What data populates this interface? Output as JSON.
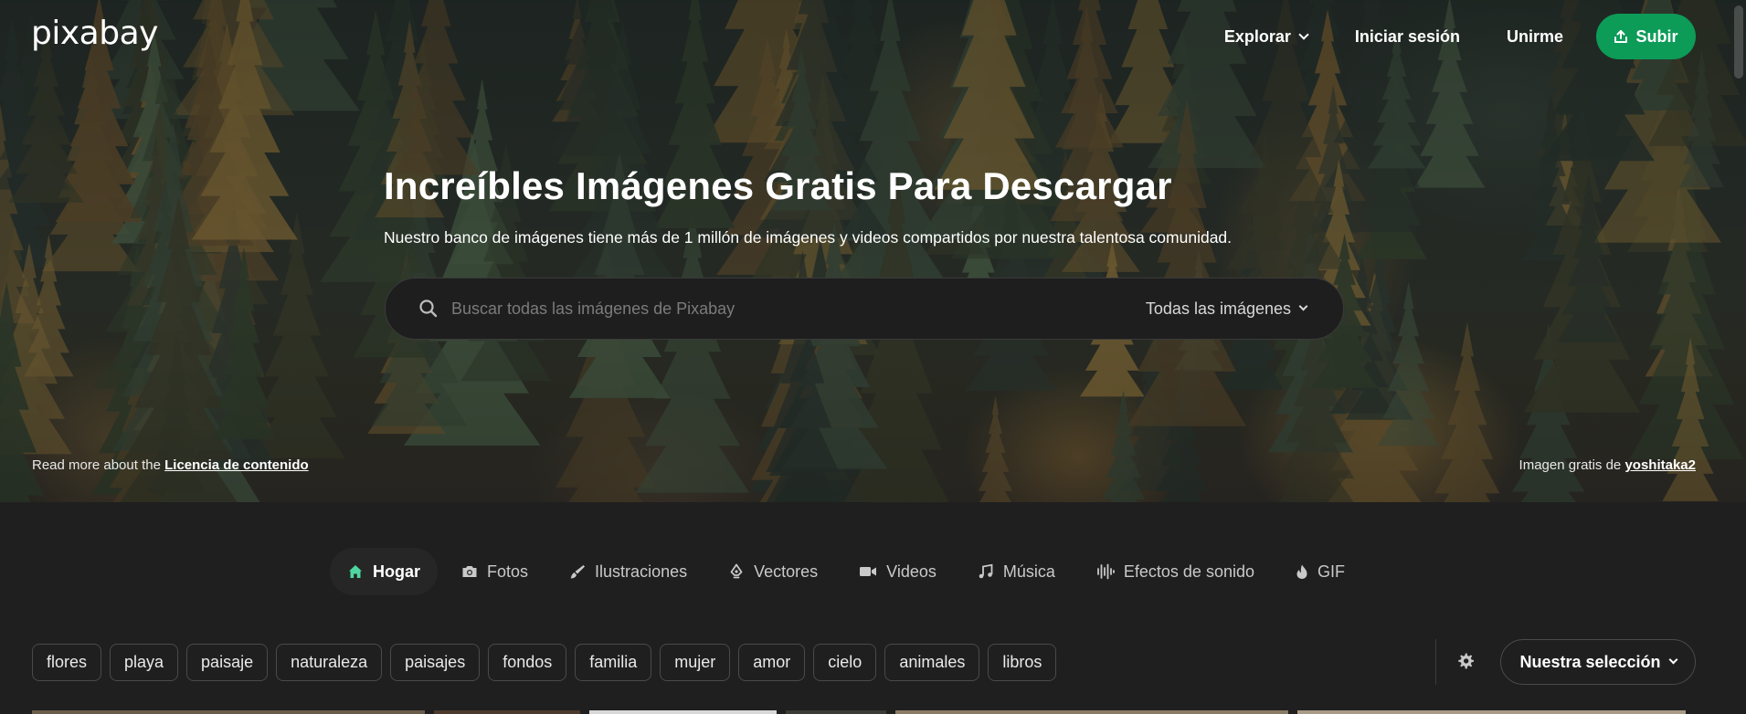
{
  "header": {
    "logo": "pixabay",
    "nav": {
      "explore": "Explorar",
      "login": "Iniciar sesión",
      "join": "Unirme",
      "upload": "Subir"
    }
  },
  "hero": {
    "title": "Increíbles Imágenes Gratis Para Descargar",
    "subtitle": "Nuestro banco de imágenes tiene más de 1 millón de imágenes y videos compartidos por nuestra talentosa comunidad.",
    "search": {
      "placeholder": "Buscar todas las imágenes de Pixabay",
      "value": "",
      "scope": "Todas las imágenes"
    },
    "footer_left": {
      "prefix": "Read more about the",
      "link": "Licencia de contenido"
    },
    "footer_right": {
      "prefix": "Imagen gratis de",
      "author": "yoshitaka2"
    }
  },
  "tabs": [
    {
      "label": "Hogar",
      "icon": "home-icon",
      "active": true
    },
    {
      "label": "Fotos",
      "icon": "camera-icon",
      "active": false
    },
    {
      "label": "Ilustraciones",
      "icon": "brush-icon",
      "active": false
    },
    {
      "label": "Vectores",
      "icon": "pen-tool-icon",
      "active": false
    },
    {
      "label": "Videos",
      "icon": "video-camera-icon",
      "active": false
    },
    {
      "label": "Música",
      "icon": "music-note-icon",
      "active": false
    },
    {
      "label": "Efectos de sonido",
      "icon": "sound-wave-icon",
      "active": false
    },
    {
      "label": "GIF",
      "icon": "flame-icon",
      "active": false
    }
  ],
  "chips": [
    "flores",
    "playa",
    "paisaje",
    "naturaleza",
    "paisajes",
    "fondos",
    "familia",
    "mujer",
    "amor",
    "cielo",
    "animales",
    "libros"
  ],
  "filters": {
    "settings_icon": "gear-icon",
    "sort": "Nuestra selección"
  },
  "colors": {
    "accent": "#0d9b58",
    "active_home_icon": "#4fd6a0",
    "background": "#1f1f1f"
  }
}
